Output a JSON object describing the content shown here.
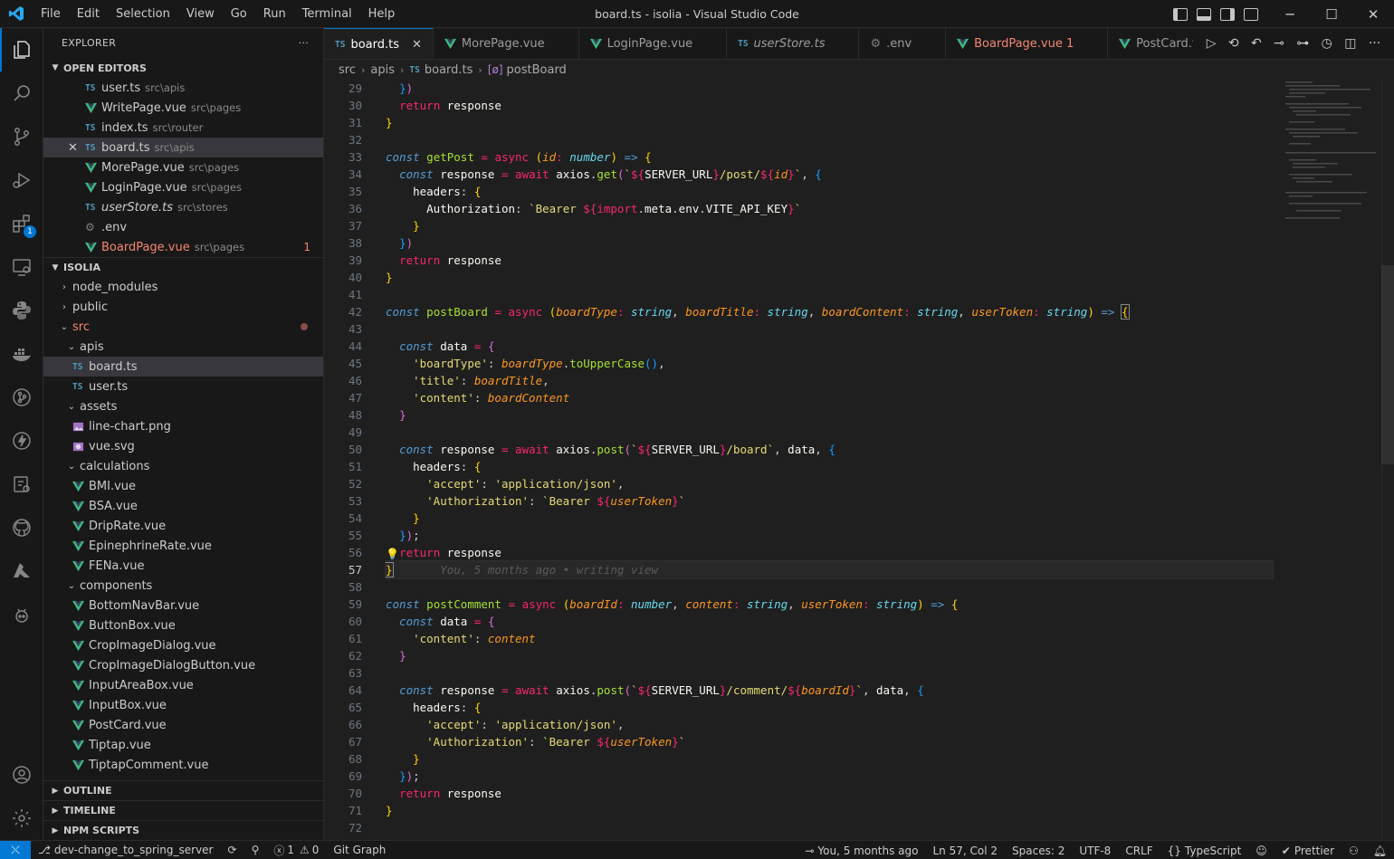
{
  "window": {
    "title": "board.ts - isolia - Visual Studio Code",
    "menu": [
      "File",
      "Edit",
      "Selection",
      "View",
      "Go",
      "Run",
      "Terminal",
      "Help"
    ]
  },
  "activity": {
    "extensions_badge": "1"
  },
  "sidebar": {
    "title": "EXPLORER",
    "more": "···",
    "open_editors_label": "OPEN EDITORS",
    "open_editors": [
      {
        "name": "user.ts",
        "path": "src\\apis",
        "icon": "ts"
      },
      {
        "name": "WritePage.vue",
        "path": "src\\pages",
        "icon": "vue"
      },
      {
        "name": "index.ts",
        "path": "src\\router",
        "icon": "ts"
      },
      {
        "name": "board.ts",
        "path": "src\\apis",
        "icon": "ts"
      },
      {
        "name": "MorePage.vue",
        "path": "src\\pages",
        "icon": "vue"
      },
      {
        "name": "LoginPage.vue",
        "path": "src\\pages",
        "icon": "vue"
      },
      {
        "name": "userStore.ts",
        "path": "src\\stores",
        "icon": "ts"
      },
      {
        "name": ".env",
        "path": "",
        "icon": "gear"
      },
      {
        "name": "BoardPage.vue",
        "path": "src\\pages",
        "icon": "vue",
        "errors": "1"
      }
    ],
    "project_label": "ISOLIA",
    "tree": [
      {
        "name": "node_modules",
        "type": "folder"
      },
      {
        "name": "public",
        "type": "folder"
      },
      {
        "name": "src",
        "type": "folder-open"
      },
      {
        "name": "apis",
        "type": "folder-open"
      },
      {
        "name": "board.ts",
        "type": "ts"
      },
      {
        "name": "user.ts",
        "type": "ts"
      },
      {
        "name": "assets",
        "type": "folder-open"
      },
      {
        "name": "line-chart.png",
        "type": "png"
      },
      {
        "name": "vue.svg",
        "type": "svg"
      },
      {
        "name": "calculations",
        "type": "folder-open"
      },
      {
        "name": "BMI.vue",
        "type": "vue"
      },
      {
        "name": "BSA.vue",
        "type": "vue"
      },
      {
        "name": "DripRate.vue",
        "type": "vue"
      },
      {
        "name": "EpinephrineRate.vue",
        "type": "vue"
      },
      {
        "name": "FENa.vue",
        "type": "vue"
      },
      {
        "name": "components",
        "type": "folder-open"
      },
      {
        "name": "BottomNavBar.vue",
        "type": "vue"
      },
      {
        "name": "ButtonBox.vue",
        "type": "vue"
      },
      {
        "name": "CropImageDialog.vue",
        "type": "vue"
      },
      {
        "name": "CropImageDialogButton.vue",
        "type": "vue"
      },
      {
        "name": "InputAreaBox.vue",
        "type": "vue"
      },
      {
        "name": "InputBox.vue",
        "type": "vue"
      },
      {
        "name": "PostCard.vue",
        "type": "vue"
      },
      {
        "name": "Tiptap.vue",
        "type": "vue"
      },
      {
        "name": "TiptapComment.vue",
        "type": "vue"
      }
    ],
    "outline": "OUTLINE",
    "timeline": "TIMELINE",
    "npm": "NPM SCRIPTS"
  },
  "tabs": [
    {
      "name": "board.ts",
      "icon": "ts",
      "active": true
    },
    {
      "name": "MorePage.vue",
      "icon": "vue"
    },
    {
      "name": "LoginPage.vue",
      "icon": "vue"
    },
    {
      "name": "userStore.ts",
      "icon": "ts"
    },
    {
      "name": ".env",
      "icon": "gear"
    },
    {
      "name": "BoardPage.vue 1",
      "icon": "vue",
      "error": true
    },
    {
      "name": "PostCard.vue",
      "icon": "vue"
    }
  ],
  "breadcrumb": {
    "items": [
      "src",
      "apis",
      "board.ts",
      "postBoard"
    ]
  },
  "editor": {
    "line_numbers": [
      "29",
      "30",
      "31",
      "32",
      "33",
      "34",
      "35",
      "36",
      "37",
      "38",
      "39",
      "40",
      "41",
      "42",
      "43",
      "44",
      "45",
      "46",
      "47",
      "48",
      "49",
      "50",
      "51",
      "52",
      "53",
      "54",
      "55",
      "56",
      "57",
      "58",
      "59",
      "60",
      "61",
      "62",
      "63",
      "64",
      "65",
      "66",
      "67",
      "68",
      "69",
      "70",
      "71",
      "72"
    ],
    "current_line": "57",
    "blame": "You, 5 months ago • writing view"
  },
  "status": {
    "branch": "dev-change_to_spring_server",
    "errors": "1",
    "warnings": "0",
    "git_graph": "Git Graph",
    "blame": "You, 5 months ago",
    "position": "Ln 57, Col 2",
    "spaces": "Spaces: 2",
    "encoding": "UTF-8",
    "eol": "CRLF",
    "language": "TypeScript",
    "prettier": "Prettier"
  },
  "colors": {
    "accent": "#0078d4",
    "vue_green": "#41b883",
    "ts_blue": "#519aba",
    "error": "#f48771"
  }
}
